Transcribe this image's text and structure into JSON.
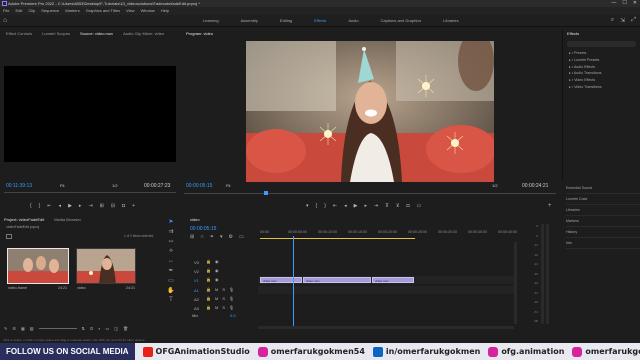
{
  "title_bar": {
    "text": "Adobe Premiere Pro 2022 - C:\\Users\\8053\\Desktop\\F-Tutorials\\10_videosolutions\\Fadeouts\\fadeEdit.prproj *",
    "min": "—",
    "max": "☐",
    "close": "✕"
  },
  "menu": [
    "File",
    "Edit",
    "Clip",
    "Sequence",
    "Markers",
    "Graphics and Titles",
    "View",
    "Window",
    "Help"
  ],
  "workspace_tabs": [
    {
      "label": "Learning",
      "active": false
    },
    {
      "label": "Assembly",
      "active": false
    },
    {
      "label": "Editing",
      "active": false
    },
    {
      "label": "Effects",
      "active": true
    },
    {
      "label": "Audio",
      "active": false
    },
    {
      "label": "Captions and Graphics",
      "active": false
    },
    {
      "label": "Libraries",
      "active": false
    }
  ],
  "source_panel": {
    "tabs": [
      {
        "label": "Effect Controls",
        "active": false
      },
      {
        "label": "Lumetri Scopes",
        "active": false
      },
      {
        "label": "Source: video.mov",
        "active": true
      },
      {
        "label": "Audio Clip Mixer: video",
        "active": false
      }
    ],
    "timecode_left": "00:11:39:13",
    "fit": "Fit",
    "ratio": "1/2",
    "timecode_right": "00:00:27:23"
  },
  "program_panel": {
    "tab": "Program: video",
    "timecode_left": "00:00:05:15",
    "fit": "Fit",
    "ratio": "1/2",
    "timecode_right": "00:00:24:21"
  },
  "effects_panel": {
    "title": "Effects",
    "items": [
      "Presets",
      "Lumetri Presets",
      "Audio Effects",
      "Audio Transitions",
      "Video Effects",
      "Video Transitions"
    ]
  },
  "right_panels": [
    "Essential Sound",
    "Lumetri Color",
    "Libraries",
    "Markers",
    "History",
    "Info"
  ],
  "project_panel": {
    "tabs": [
      {
        "label": "Project: videoFadeEdit",
        "active": true
      },
      {
        "label": "Media Browser",
        "active": false
      }
    ],
    "file": "videoFadeEdit.prproj",
    "selection": "1 of 2 items selected",
    "items": [
      {
        "name": "video-frame",
        "duration": "24:21",
        "selected": true
      },
      {
        "name": "video",
        "duration": "24:21",
        "selected": false
      }
    ]
  },
  "timeline": {
    "tab": "video",
    "timecode": "00:00:05:15",
    "ruler": [
      "00:00",
      "00:00:05:00",
      "00:00:10:00",
      "00:00:15:00",
      "00:00:20:00",
      "00:00:25:00",
      "00:00:30:00",
      "00:00:35:00",
      "00:00:40:00"
    ],
    "video_tracks": [
      "V3",
      "V2",
      "V1"
    ],
    "audio_tracks": [
      "A1",
      "A2",
      "A3"
    ],
    "mix": "Mix",
    "mix_value": "0.0",
    "clips": [
      {
        "label": "video.mov"
      },
      {
        "label": "video.mov"
      },
      {
        "label": "video.mov"
      }
    ]
  },
  "meter_labels": [
    "0",
    "-6",
    "-12",
    "-18",
    "-24",
    "-30",
    "-36",
    "-42",
    "-48",
    "-54",
    "dB"
  ],
  "status": "Click to select, or click in empty space and drag to marquee select. Use Shift, Alt, and Ctrl for other options.",
  "footer": {
    "follow": "FOLLOW US ON SOCIAL MEDIA",
    "youtube": "OFGAnimationStudio",
    "instagram": "omerfarukgokmen54",
    "linkedin": "in/omerfarukgokmen",
    "web": "ofg.animation",
    "instagram2": "omerfarukgokmen",
    "colors": {
      "youtube": "#e62117",
      "instagram": "#d6249f",
      "linkedin": "#0a66c2",
      "web": "#d6249f",
      "follow_bg": "#2a2e5c",
      "accent": "#3b9cff",
      "clip": "#a79ad9"
    }
  }
}
